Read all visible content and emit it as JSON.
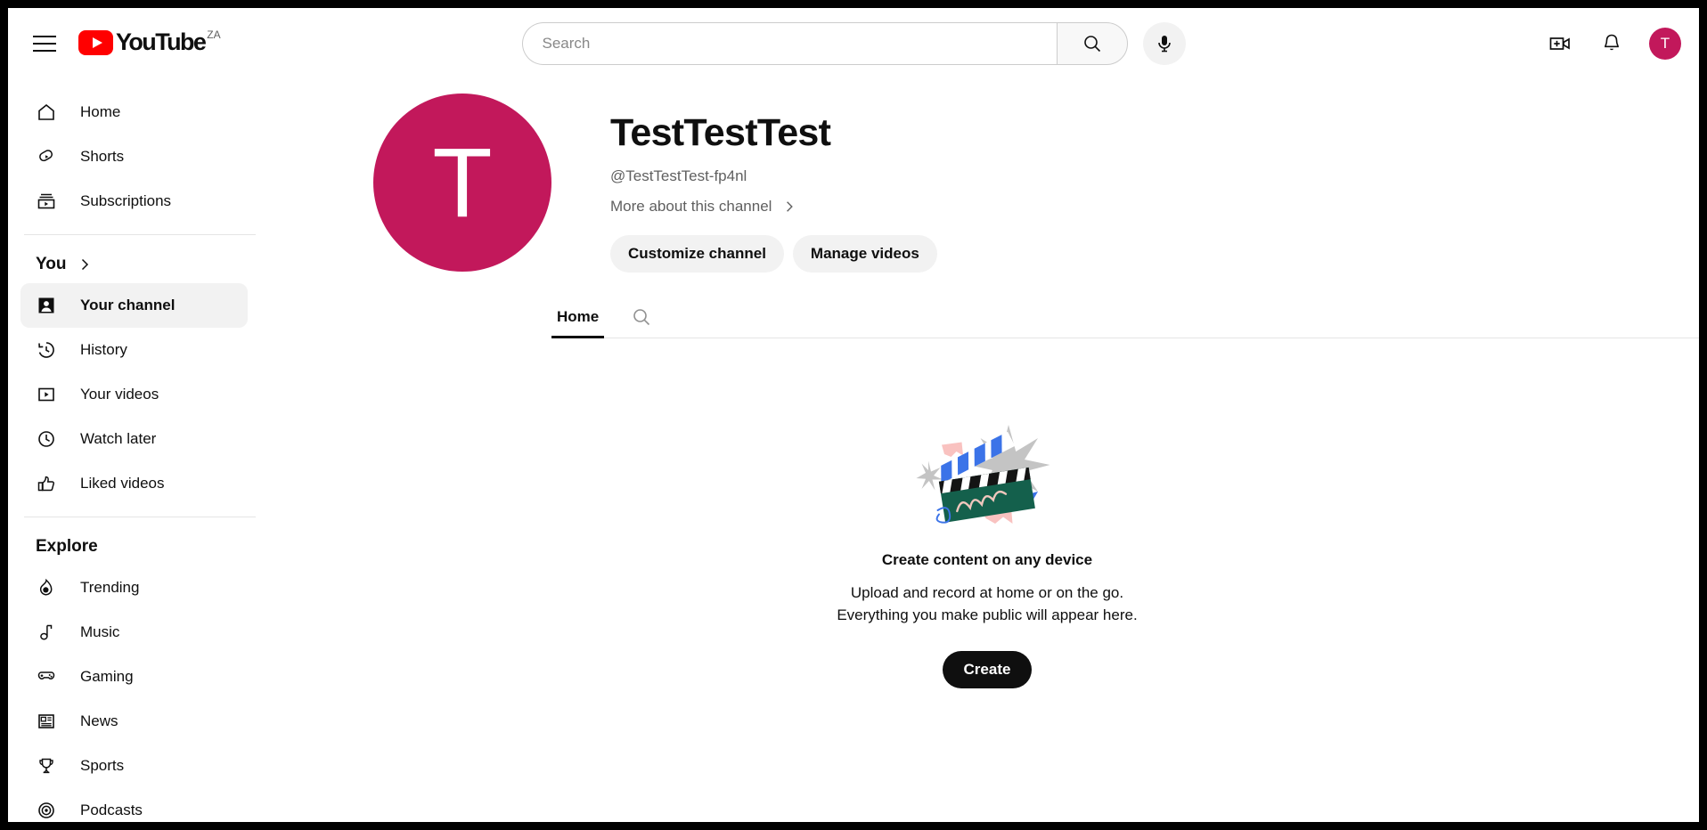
{
  "header": {
    "menu_icon": "hamburger-menu-icon",
    "logo_text": "YouTube",
    "logo_country": "ZA",
    "search_placeholder": "Search",
    "search_value": "",
    "search_icon": "search-icon",
    "mic_icon": "microphone-icon",
    "create_icon": "create-video-icon",
    "notifications_icon": "bell-icon",
    "avatar_letter": "T",
    "avatar_color": "#c2185b"
  },
  "sidebar": {
    "primary": [
      {
        "label": "Home",
        "icon": "home-icon",
        "active": false
      },
      {
        "label": "Shorts",
        "icon": "shorts-icon",
        "active": false
      },
      {
        "label": "Subscriptions",
        "icon": "subscriptions-icon",
        "active": false
      }
    ],
    "you_section": {
      "label": "You",
      "chevron_icon": "chevron-right-icon"
    },
    "you_items": [
      {
        "label": "Your channel",
        "icon": "person-icon",
        "active": true
      },
      {
        "label": "History",
        "icon": "history-icon",
        "active": false
      },
      {
        "label": "Your videos",
        "icon": "your-videos-icon",
        "active": false
      },
      {
        "label": "Watch later",
        "icon": "clock-icon",
        "active": false
      },
      {
        "label": "Liked videos",
        "icon": "thumbs-up-icon",
        "active": false
      }
    ],
    "explore_section": {
      "label": "Explore"
    },
    "explore_items": [
      {
        "label": "Trending",
        "icon": "trending-flame-icon",
        "active": false
      },
      {
        "label": "Music",
        "icon": "music-note-icon",
        "active": false
      },
      {
        "label": "Gaming",
        "icon": "gamepad-icon",
        "active": false
      },
      {
        "label": "News",
        "icon": "news-icon",
        "active": false
      },
      {
        "label": "Sports",
        "icon": "trophy-icon",
        "active": false
      },
      {
        "label": "Podcasts",
        "icon": "podcast-icon",
        "active": false
      }
    ]
  },
  "channel": {
    "avatar_letter": "T",
    "avatar_color": "#c2185b",
    "name": "TestTestTest",
    "handle": "@TestTestTest-fp4nl",
    "more_link": "More about this channel",
    "more_chevron_icon": "chevron-right-icon",
    "customize_button": "Customize channel",
    "manage_button": "Manage videos"
  },
  "tabs": [
    {
      "label": "Home",
      "active": true
    }
  ],
  "tab_search_icon": "search-icon",
  "empty_state": {
    "illustration": "clapperboard-illustration",
    "title": "Create content on any device",
    "line1": "Upload and record at home or on the go.",
    "line2": "Everything you make public will appear here.",
    "button": "Create"
  }
}
